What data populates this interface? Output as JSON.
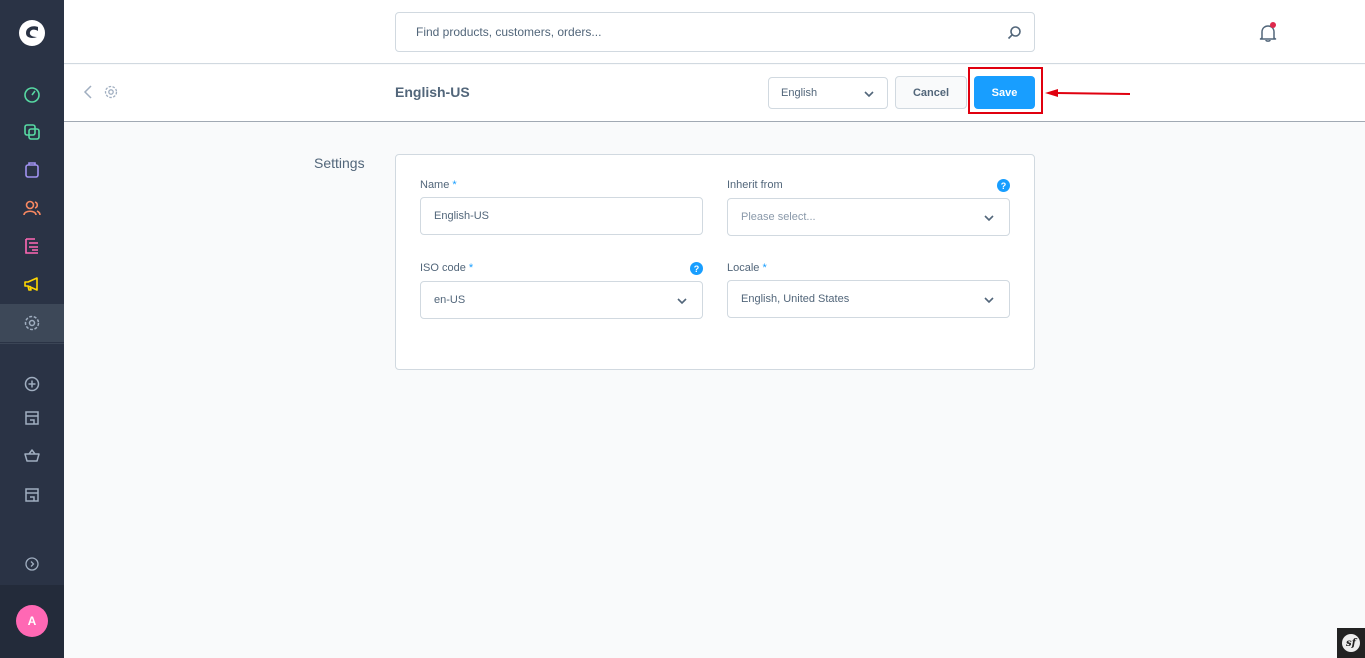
{
  "header": {
    "search_placeholder": "Find products, customers, orders..."
  },
  "smartbar": {
    "title": "English-US",
    "language_select_value": "English",
    "cancel_label": "Cancel",
    "save_label": "Save"
  },
  "section": {
    "label": "Settings"
  },
  "form": {
    "name": {
      "label": "Name",
      "required_mark": "*",
      "value": "English-US"
    },
    "inherit_from": {
      "label": "Inherit from",
      "placeholder": "Please select...",
      "help": "?"
    },
    "iso_code": {
      "label": "ISO code",
      "required_mark": "*",
      "value": "en-US",
      "help": "?"
    },
    "locale": {
      "label": "Locale",
      "required_mark": "*",
      "value": "English, United States"
    }
  },
  "user": {
    "avatar_initial": "A"
  },
  "sidebar": {
    "items": [
      {
        "icon": "dashboard-icon",
        "color": "#57d9a3"
      },
      {
        "icon": "catalogue-icon",
        "color": "#57d9a3"
      },
      {
        "icon": "orders-icon",
        "color": "#a092f0"
      },
      {
        "icon": "customers-icon",
        "color": "#f88962"
      },
      {
        "icon": "content-icon",
        "color": "#ff68b4"
      },
      {
        "icon": "marketing-icon",
        "color": "#ffd700"
      },
      {
        "icon": "settings-icon",
        "color": "#a0aec0"
      }
    ]
  },
  "colors": {
    "accent": "#189eff",
    "sidebar_bg": "#2a3345",
    "annotation_red": "#e0000f"
  },
  "debug_badge": {
    "text": "sf"
  }
}
